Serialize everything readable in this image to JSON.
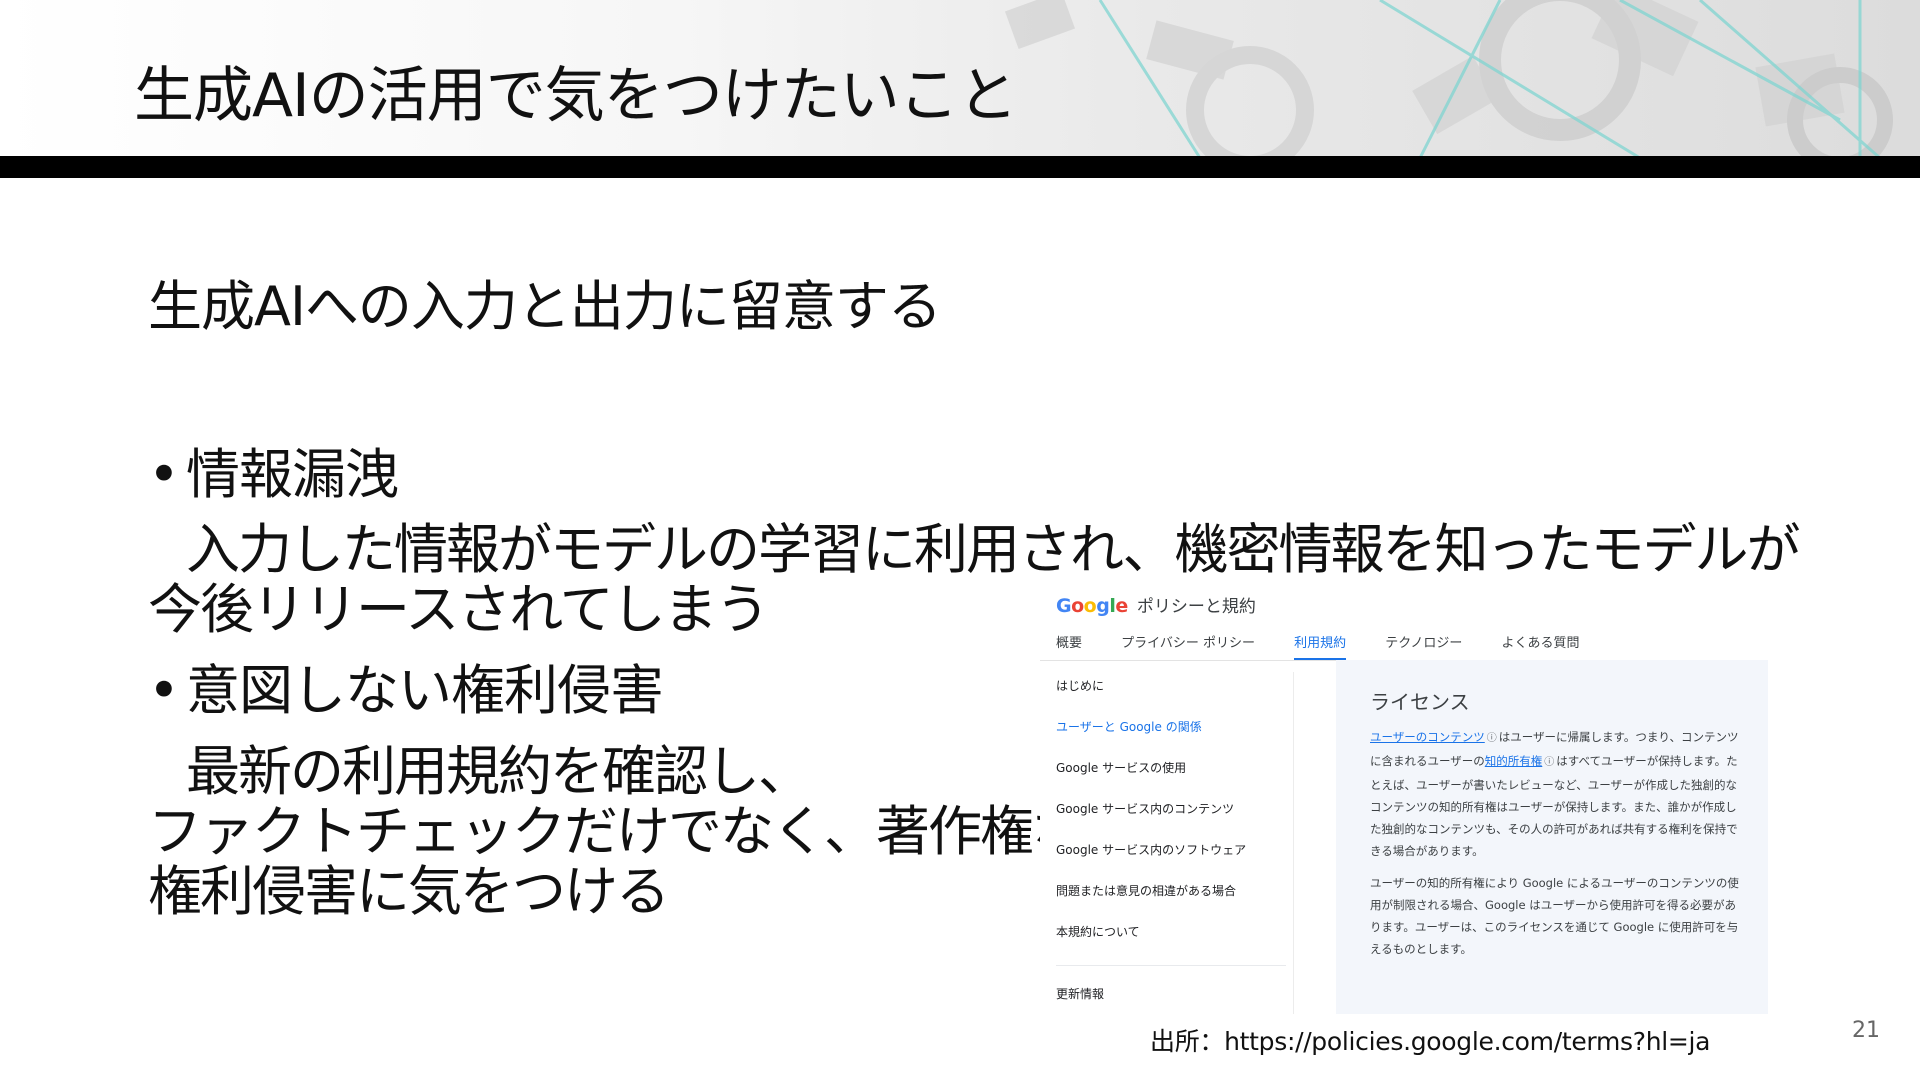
{
  "slide": {
    "title": "生成AIの活用で気をつけたいこと",
    "lead": "生成AIへの入力と出力に留意する",
    "bullet_1": {
      "dot": "•",
      "heading": "情報漏洩",
      "lines": [
        "入力した情報がモデルの学習に利用され、機密情報を知ったモデルが",
        "今後リリースされてしまう"
      ]
    },
    "bullet_2": {
      "dot": "•",
      "heading": "意図しない権利侵害",
      "lines": [
        "最新の利用規約を確認し、",
        "ファクトチェックだけでなく、著作権などの",
        "権利侵害に気をつける"
      ]
    },
    "source": "出所：https://policies.google.com/terms?hl=ja",
    "page_number": "21"
  },
  "screenshot": {
    "logo_letters": [
      "G",
      "o",
      "o",
      "g",
      "l",
      "e"
    ],
    "site_title": "ポリシーと規約",
    "tabs": [
      "概要",
      "プライバシー ポリシー",
      "利用規約",
      "テクノロジー",
      "よくある質問"
    ],
    "active_tab": "利用規約",
    "sidebar": [
      "はじめに",
      "ユーザーと Google の関係",
      "Google サービスの使用",
      "Google サービス内のコンテンツ",
      "Google サービス内のソフトウェア",
      "問題または意見の相違がある場合",
      "本規約について"
    ],
    "sidebar_active": "ユーザーと Google の関係",
    "sidebar_footer": "更新情報",
    "heading": "ライセンス",
    "paragraph_1": {
      "link_1": "ユーザーのコンテンツ",
      "text_1": "はユーザーに帰属します。つまり、コンテンツに含まれるユーザーの",
      "link_2": "知的所有権",
      "text_2": "はすべてユーザーが保持します。たとえば、ユーザーが書いたレビューなど、ユーザーが作成した独創的なコンテンツの知的所有権はユーザーが保持します。また、誰かが作成した独創的なコンテンツも、その人の許可があれば共有する権利を保持できる場合があります。"
    },
    "paragraph_2": "ユーザーの知的所有権により Google によるユーザーのコンテンツの使用が制限される場合、Google はユーザーから使用許可を得る必要があります。ユーザーは、このライセンスを通じて Google に使用許可を与えるものとします。",
    "info_glyph": "ⓘ"
  },
  "colors": {
    "google_blue": "#4285F4",
    "google_red": "#EA4335",
    "google_yellow": "#FBBC05",
    "google_green": "#34A853",
    "link_blue": "#1a73e8",
    "header_bar": "#000000"
  }
}
